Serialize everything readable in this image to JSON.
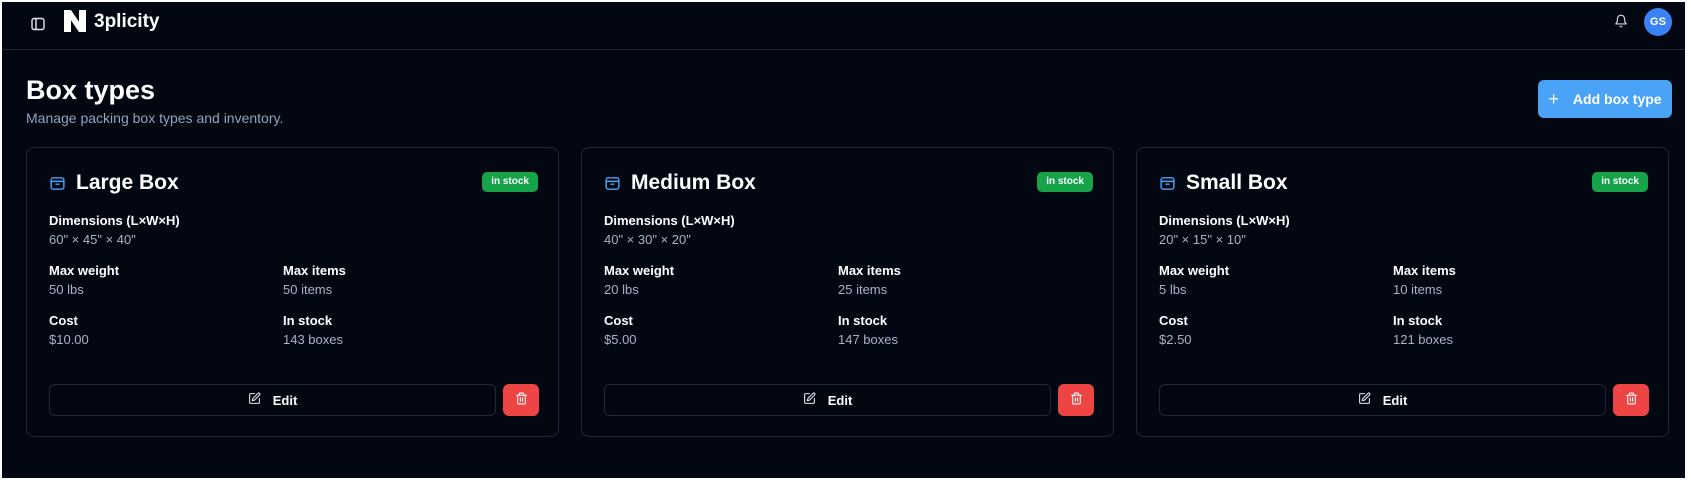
{
  "app": {
    "name": "3plicity"
  },
  "user": {
    "initials": "GS"
  },
  "header": {
    "title": "Box types",
    "subtitle": "Manage packing box types and inventory.",
    "add_button_label": "Add box type"
  },
  "colors": {
    "accent": "#4aa3f6",
    "badge": "#16a34a",
    "danger": "#ef4444",
    "background": "#030712"
  },
  "icons": {
    "sidebar_toggle": "sidebar-toggle-icon",
    "notifications": "bell-icon",
    "add": "plus-icon",
    "box": "box-icon",
    "edit": "pencil-square-icon",
    "delete": "trash-icon"
  },
  "labels": {
    "dimensions": "Dimensions (L×W×H)",
    "max_weight": "Max weight",
    "max_items": "Max items",
    "cost": "Cost",
    "in_stock": "In stock",
    "edit": "Edit"
  },
  "boxes": [
    {
      "name": "Large Box",
      "status": "in stock",
      "dimensions": "60\" × 45\" × 40\"",
      "max_weight": "50 lbs",
      "max_items": "50 items",
      "cost": "$10.00",
      "in_stock": "143 boxes"
    },
    {
      "name": "Medium Box",
      "status": "in stock",
      "dimensions": "40\" × 30\" × 20\"",
      "max_weight": "20 lbs",
      "max_items": "25 items",
      "cost": "$5.00",
      "in_stock": "147 boxes"
    },
    {
      "name": "Small Box",
      "status": "in stock",
      "dimensions": "20\" × 15\" × 10\"",
      "max_weight": "5 lbs",
      "max_items": "10 items",
      "cost": "$2.50",
      "in_stock": "121 boxes"
    }
  ]
}
